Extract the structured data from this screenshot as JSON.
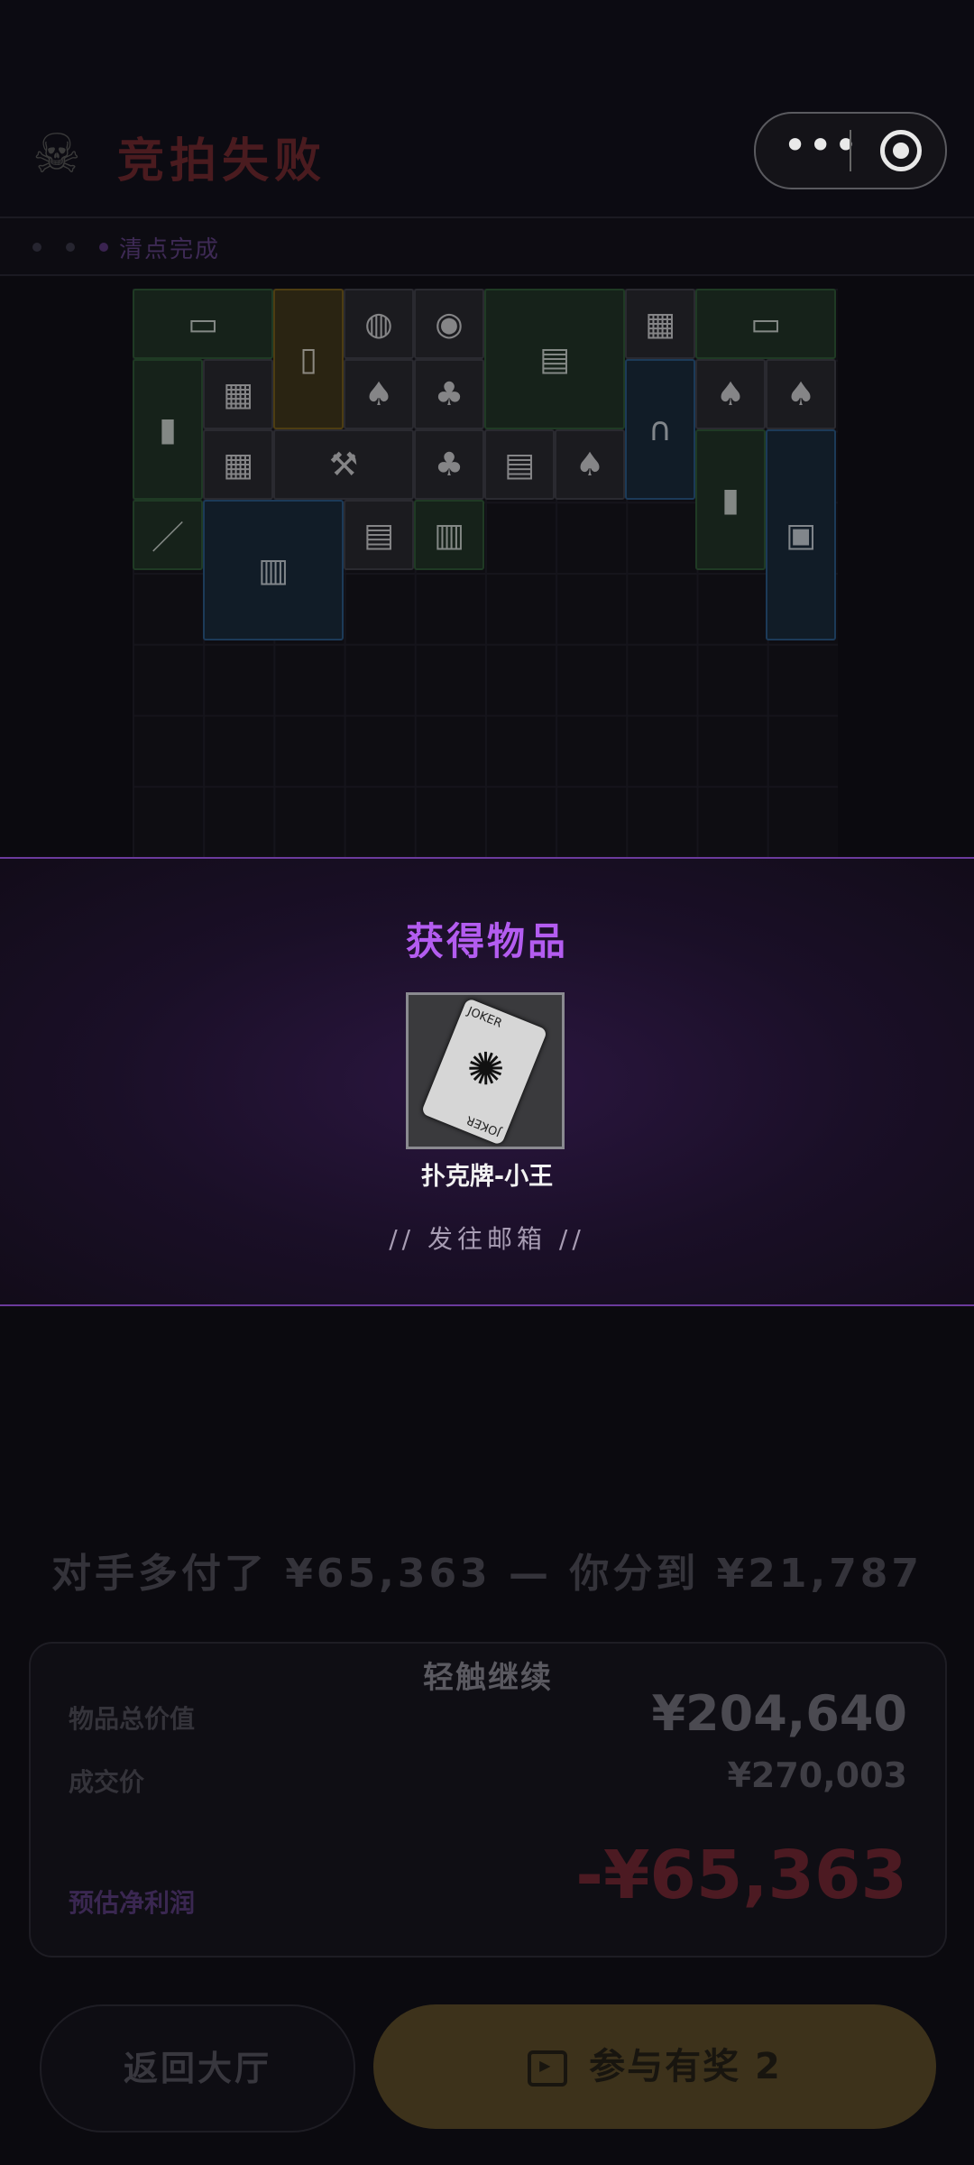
{
  "header": {
    "title": "竞拍失败",
    "skull_icon": "skull-icon",
    "more_icon": "more-dots-icon",
    "target_icon": "target-icon"
  },
  "status": {
    "label": "清点完成"
  },
  "inventory": {
    "items": [
      {
        "name": "sack",
        "color": "green"
      },
      {
        "name": "card",
        "color": "yellow"
      },
      {
        "name": "mouse",
        "color": "neutral"
      },
      {
        "name": "tape",
        "color": "neutral"
      },
      {
        "name": "newspaper",
        "color": "green"
      },
      {
        "name": "crate",
        "color": "neutral"
      },
      {
        "name": "sack-2",
        "color": "green"
      },
      {
        "name": "phone-booth",
        "color": "green"
      },
      {
        "name": "crate-2",
        "color": "neutral"
      },
      {
        "name": "card-2",
        "color": "neutral"
      },
      {
        "name": "card-3",
        "color": "neutral"
      },
      {
        "name": "stethoscope",
        "color": "blue"
      },
      {
        "name": "card-4",
        "color": "neutral"
      },
      {
        "name": "card-5",
        "color": "neutral"
      },
      {
        "name": "crate-3",
        "color": "neutral"
      },
      {
        "name": "hammer",
        "color": "neutral"
      },
      {
        "name": "card-6",
        "color": "neutral"
      },
      {
        "name": "paper",
        "color": "neutral"
      },
      {
        "name": "card-7",
        "color": "neutral"
      },
      {
        "name": "phone-booth-2",
        "color": "green"
      },
      {
        "name": "machine",
        "color": "blue"
      },
      {
        "name": "pen",
        "color": "green"
      },
      {
        "name": "magazine",
        "color": "blue"
      },
      {
        "name": "documents",
        "color": "neutral"
      },
      {
        "name": "bottle",
        "color": "green"
      }
    ]
  },
  "reward": {
    "title": "获得物品",
    "item_name": "扑克牌-小王",
    "card_text_top": "JOKER",
    "card_text_bottom": "JOKER",
    "mail_text": "// 发往邮箱 //"
  },
  "summary": {
    "headline": "对手多付了 ¥65,363 — 你分到 ¥21,787",
    "tap_continue": "轻触继续",
    "total_label": "物品总价值",
    "total_value": "¥204,640",
    "deal_label": "成交价",
    "deal_value": "¥270,003",
    "profit_label": "预估净利润",
    "profit_value": "-¥65,363"
  },
  "buttons": {
    "back": "返回大厅",
    "join": "参与有奖 2"
  },
  "colors": {
    "accent_purple": "#b35cf0",
    "loss_red": "#4c1a22",
    "gold_button": "#3d321b"
  }
}
